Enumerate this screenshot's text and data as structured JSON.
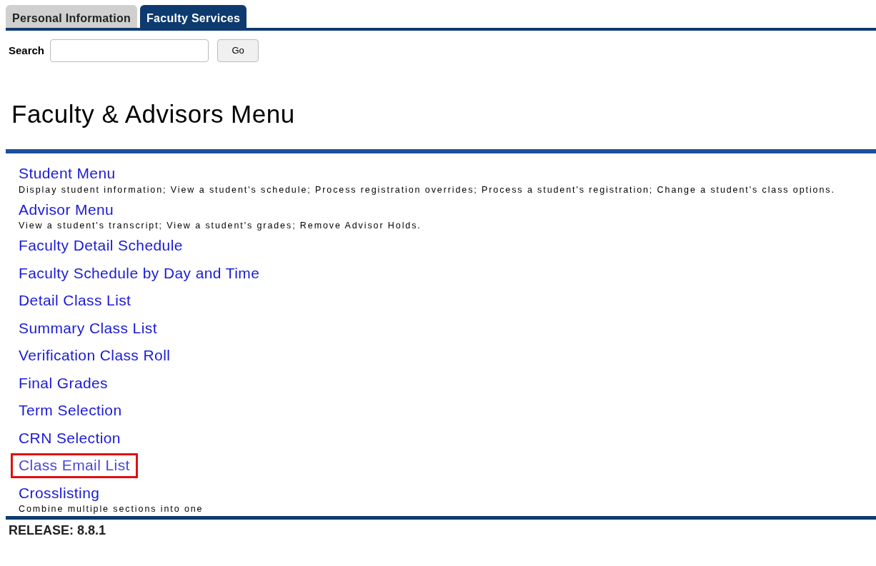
{
  "tabs": [
    {
      "label": "Personal Information",
      "selected": false
    },
    {
      "label": "Faculty Services",
      "selected": true
    }
  ],
  "search": {
    "label": "Search",
    "button": "Go"
  },
  "heading": "Faculty & Advisors Menu",
  "menu": [
    {
      "label": "Student Menu",
      "description": "Display student information; View a student's schedule; Process registration overrides; Process a student's registration; Change a student's class options.",
      "highlighted": false
    },
    {
      "label": "Advisor Menu",
      "description": "View a student's transcript; View a student's grades; Remove Advisor Holds.",
      "highlighted": false
    },
    {
      "label": "Faculty Detail Schedule",
      "highlighted": false
    },
    {
      "label": "Faculty Schedule by Day and Time",
      "highlighted": false
    },
    {
      "label": "Detail Class List",
      "highlighted": false
    },
    {
      "label": "Summary Class List",
      "highlighted": false
    },
    {
      "label": "Verification Class Roll",
      "highlighted": false
    },
    {
      "label": "Final Grades",
      "highlighted": false
    },
    {
      "label": "Term Selection",
      "highlighted": false
    },
    {
      "label": "CRN Selection",
      "highlighted": false
    },
    {
      "label": "Class Email List",
      "highlighted": true
    },
    {
      "label": "Crosslisting",
      "description": "Combine multiple sections into one",
      "highlighted": false
    }
  ],
  "release": "RELEASE: 8.8.1"
}
